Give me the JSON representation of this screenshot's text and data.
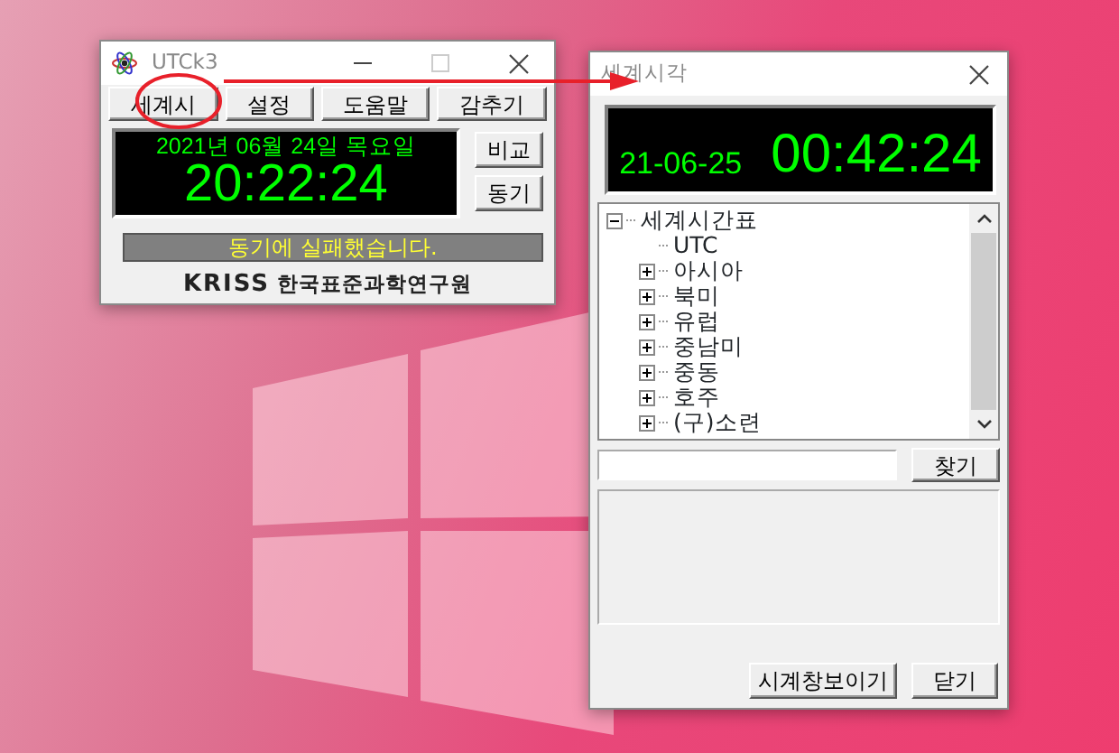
{
  "main_window": {
    "title": "UTCk3",
    "buttons": [
      "세계시",
      "설정",
      "도움말",
      "감추기"
    ],
    "date": "2021년 06월 24일 목요일",
    "time": "20:22:24",
    "side_buttons": [
      "비교",
      "동기"
    ],
    "status": "동기에 실패했습니다.",
    "logo": "KRISS",
    "institute": "한국표준과학연구원"
  },
  "world_window": {
    "title": "세계시각",
    "date": "21-06-25",
    "time": "00:42:24",
    "tree": [
      {
        "label": "세계시간표",
        "expanded": true,
        "children": [
          {
            "label": "UTC"
          },
          {
            "label": "아시아",
            "expanded": false
          },
          {
            "label": "북미",
            "expanded": false
          },
          {
            "label": "유럽",
            "expanded": false
          },
          {
            "label": "중남미",
            "expanded": false
          },
          {
            "label": "중동",
            "expanded": false
          },
          {
            "label": "호주",
            "expanded": false
          },
          {
            "label": "(구)소련",
            "expanded": false
          }
        ]
      }
    ],
    "search_button": "찾기",
    "buttons": [
      "시계창보이기",
      "닫기"
    ]
  }
}
